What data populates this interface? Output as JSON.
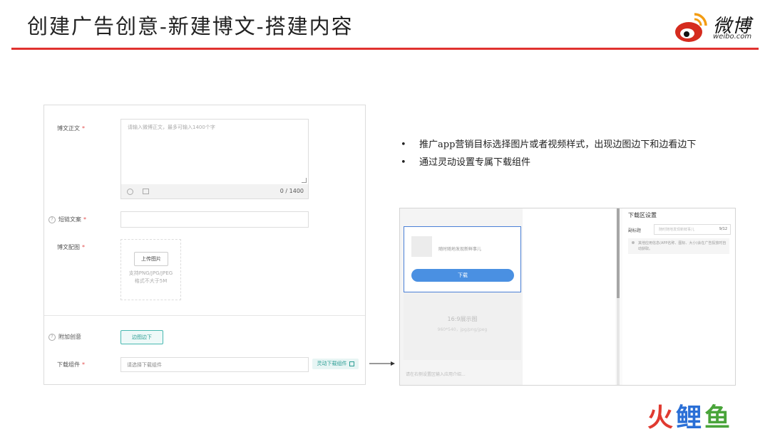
{
  "slide": {
    "title": "创建广告创意-新建博文-搭建内容",
    "logo_text": "微博",
    "logo_sub": "weibo.com"
  },
  "form": {
    "body_label": "博文正文",
    "body_placeholder": "请输入微博正文，最多可输入1400个字",
    "counter": "0 / 1400",
    "short_link_label": "短链文案",
    "image_label": "博文配图",
    "upload_button": "上传图片",
    "upload_hint_1": "支持PNG/JPG/JPEG",
    "upload_hint_2": "格式不大于5M",
    "extra_label": "附加创意",
    "side_image_button": "边图边下",
    "download_label": "下载组件",
    "download_placeholder": "请选择下载组件",
    "download_link": "灵动下载组件",
    "required_mark": "*"
  },
  "bullets": [
    "推广app营销目标选择图片或者视频样式，出现边图边下和边看边下",
    "通过灵动设置专属下载组件"
  ],
  "preview": {
    "card_title": "随时随地发现新鲜事儿",
    "card_button": "下载",
    "image_placeholder": "16:9展示图",
    "image_spec": "960*540，jpg/png/jpeg",
    "app_intro": "请在右侧设置区输入应用介绍...",
    "settings_title": "下载区设置",
    "settings_field_label": "副标题",
    "settings_field_placeholder": "随时随地发现新鲜事儿",
    "settings_field_count": "9/12",
    "settings_note": "其他应用信息(APP名称、图标、大小)会在广告投放时自动获取。"
  },
  "watermark": [
    "火",
    "鲤",
    "鱼"
  ],
  "colors": {
    "accent_rule": "#e0312f",
    "teal": "#2a9d93",
    "primary_button": "#4a90e2"
  }
}
